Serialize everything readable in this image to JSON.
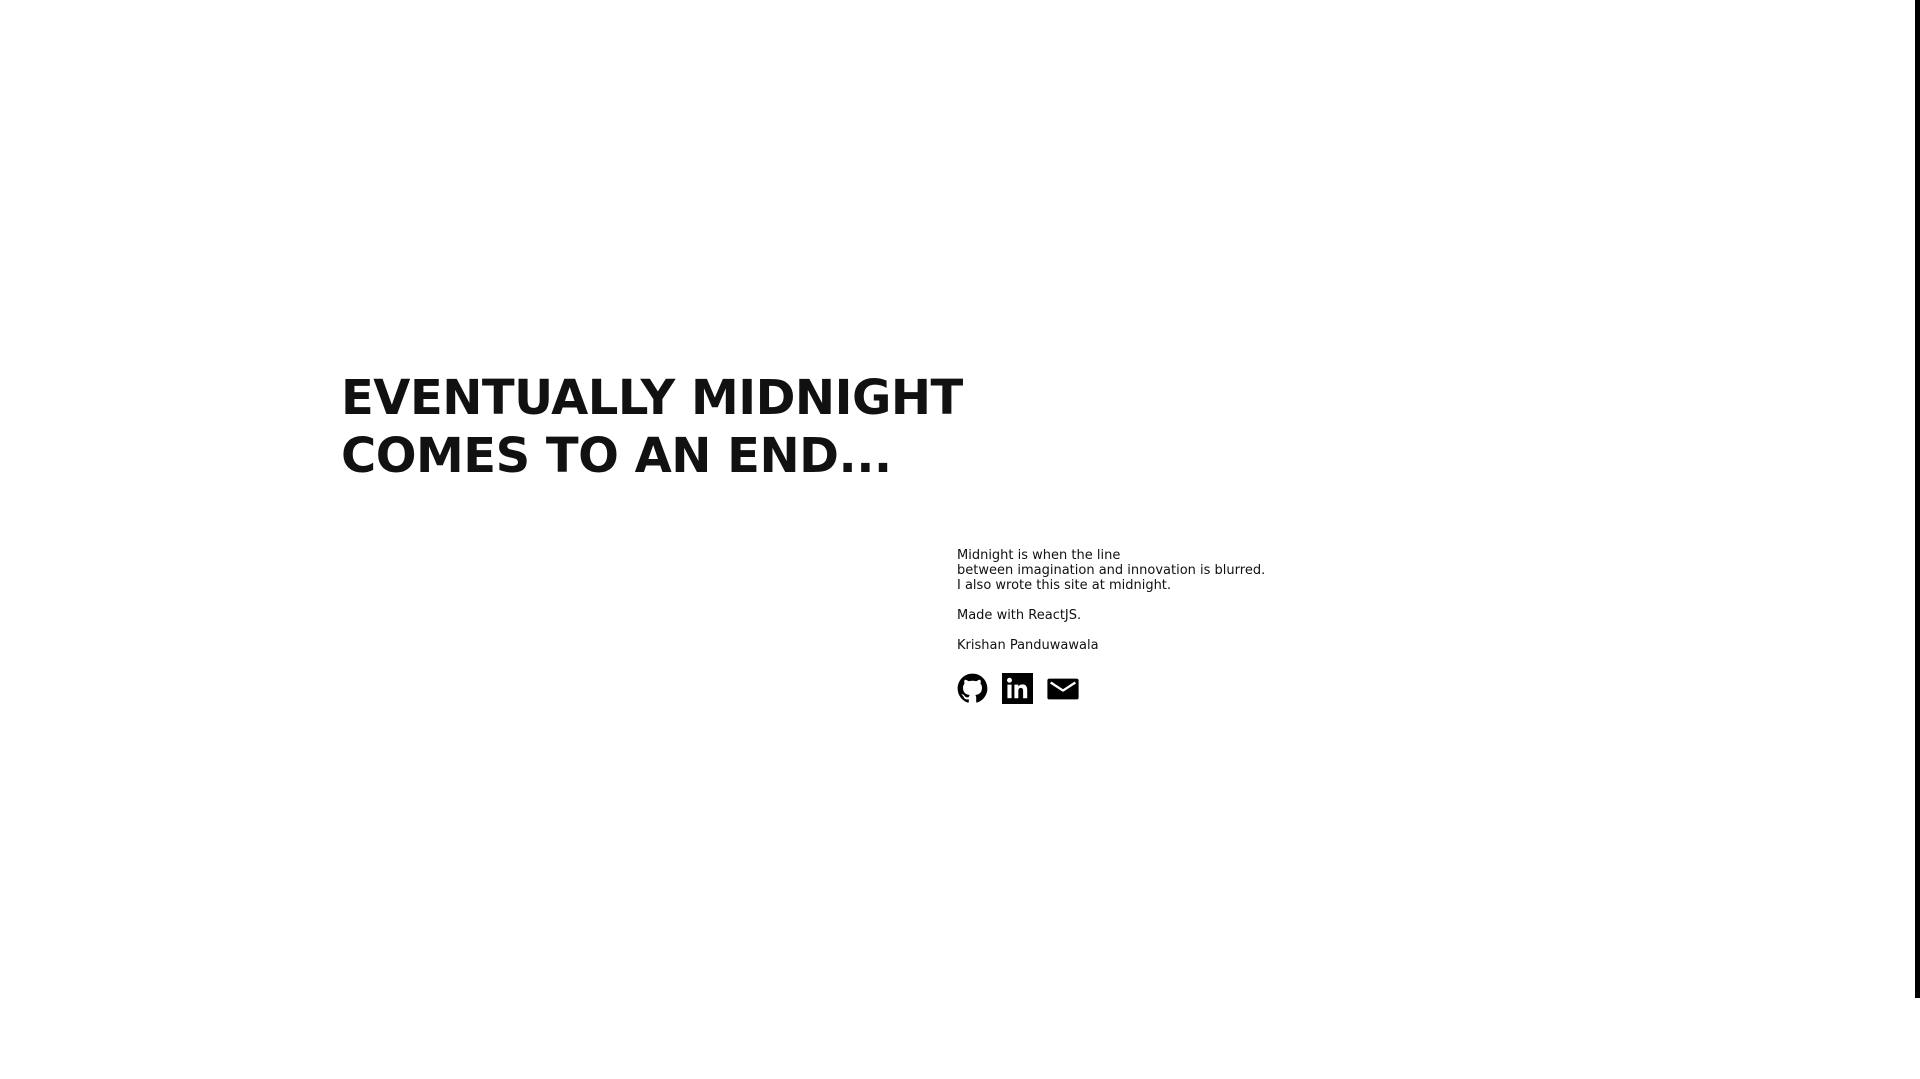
{
  "hero": {
    "line1": "EVENTUALLY MIDNIGHT",
    "line2": "COMES TO AN END..."
  },
  "about": {
    "line1": "Midnight is when the line",
    "line2": "between imagination and innovation is blurred.",
    "line3": "I also wrote this site at midnight.",
    "made_with": "Made with ReactJS.",
    "author": "Krishan Panduwawala"
  },
  "social": {
    "icons": [
      "github-icon",
      "linkedin-icon",
      "mail-icon"
    ]
  },
  "colors": {
    "background": "#ffffff",
    "text": "#111111",
    "edge_bar": "#000000"
  }
}
